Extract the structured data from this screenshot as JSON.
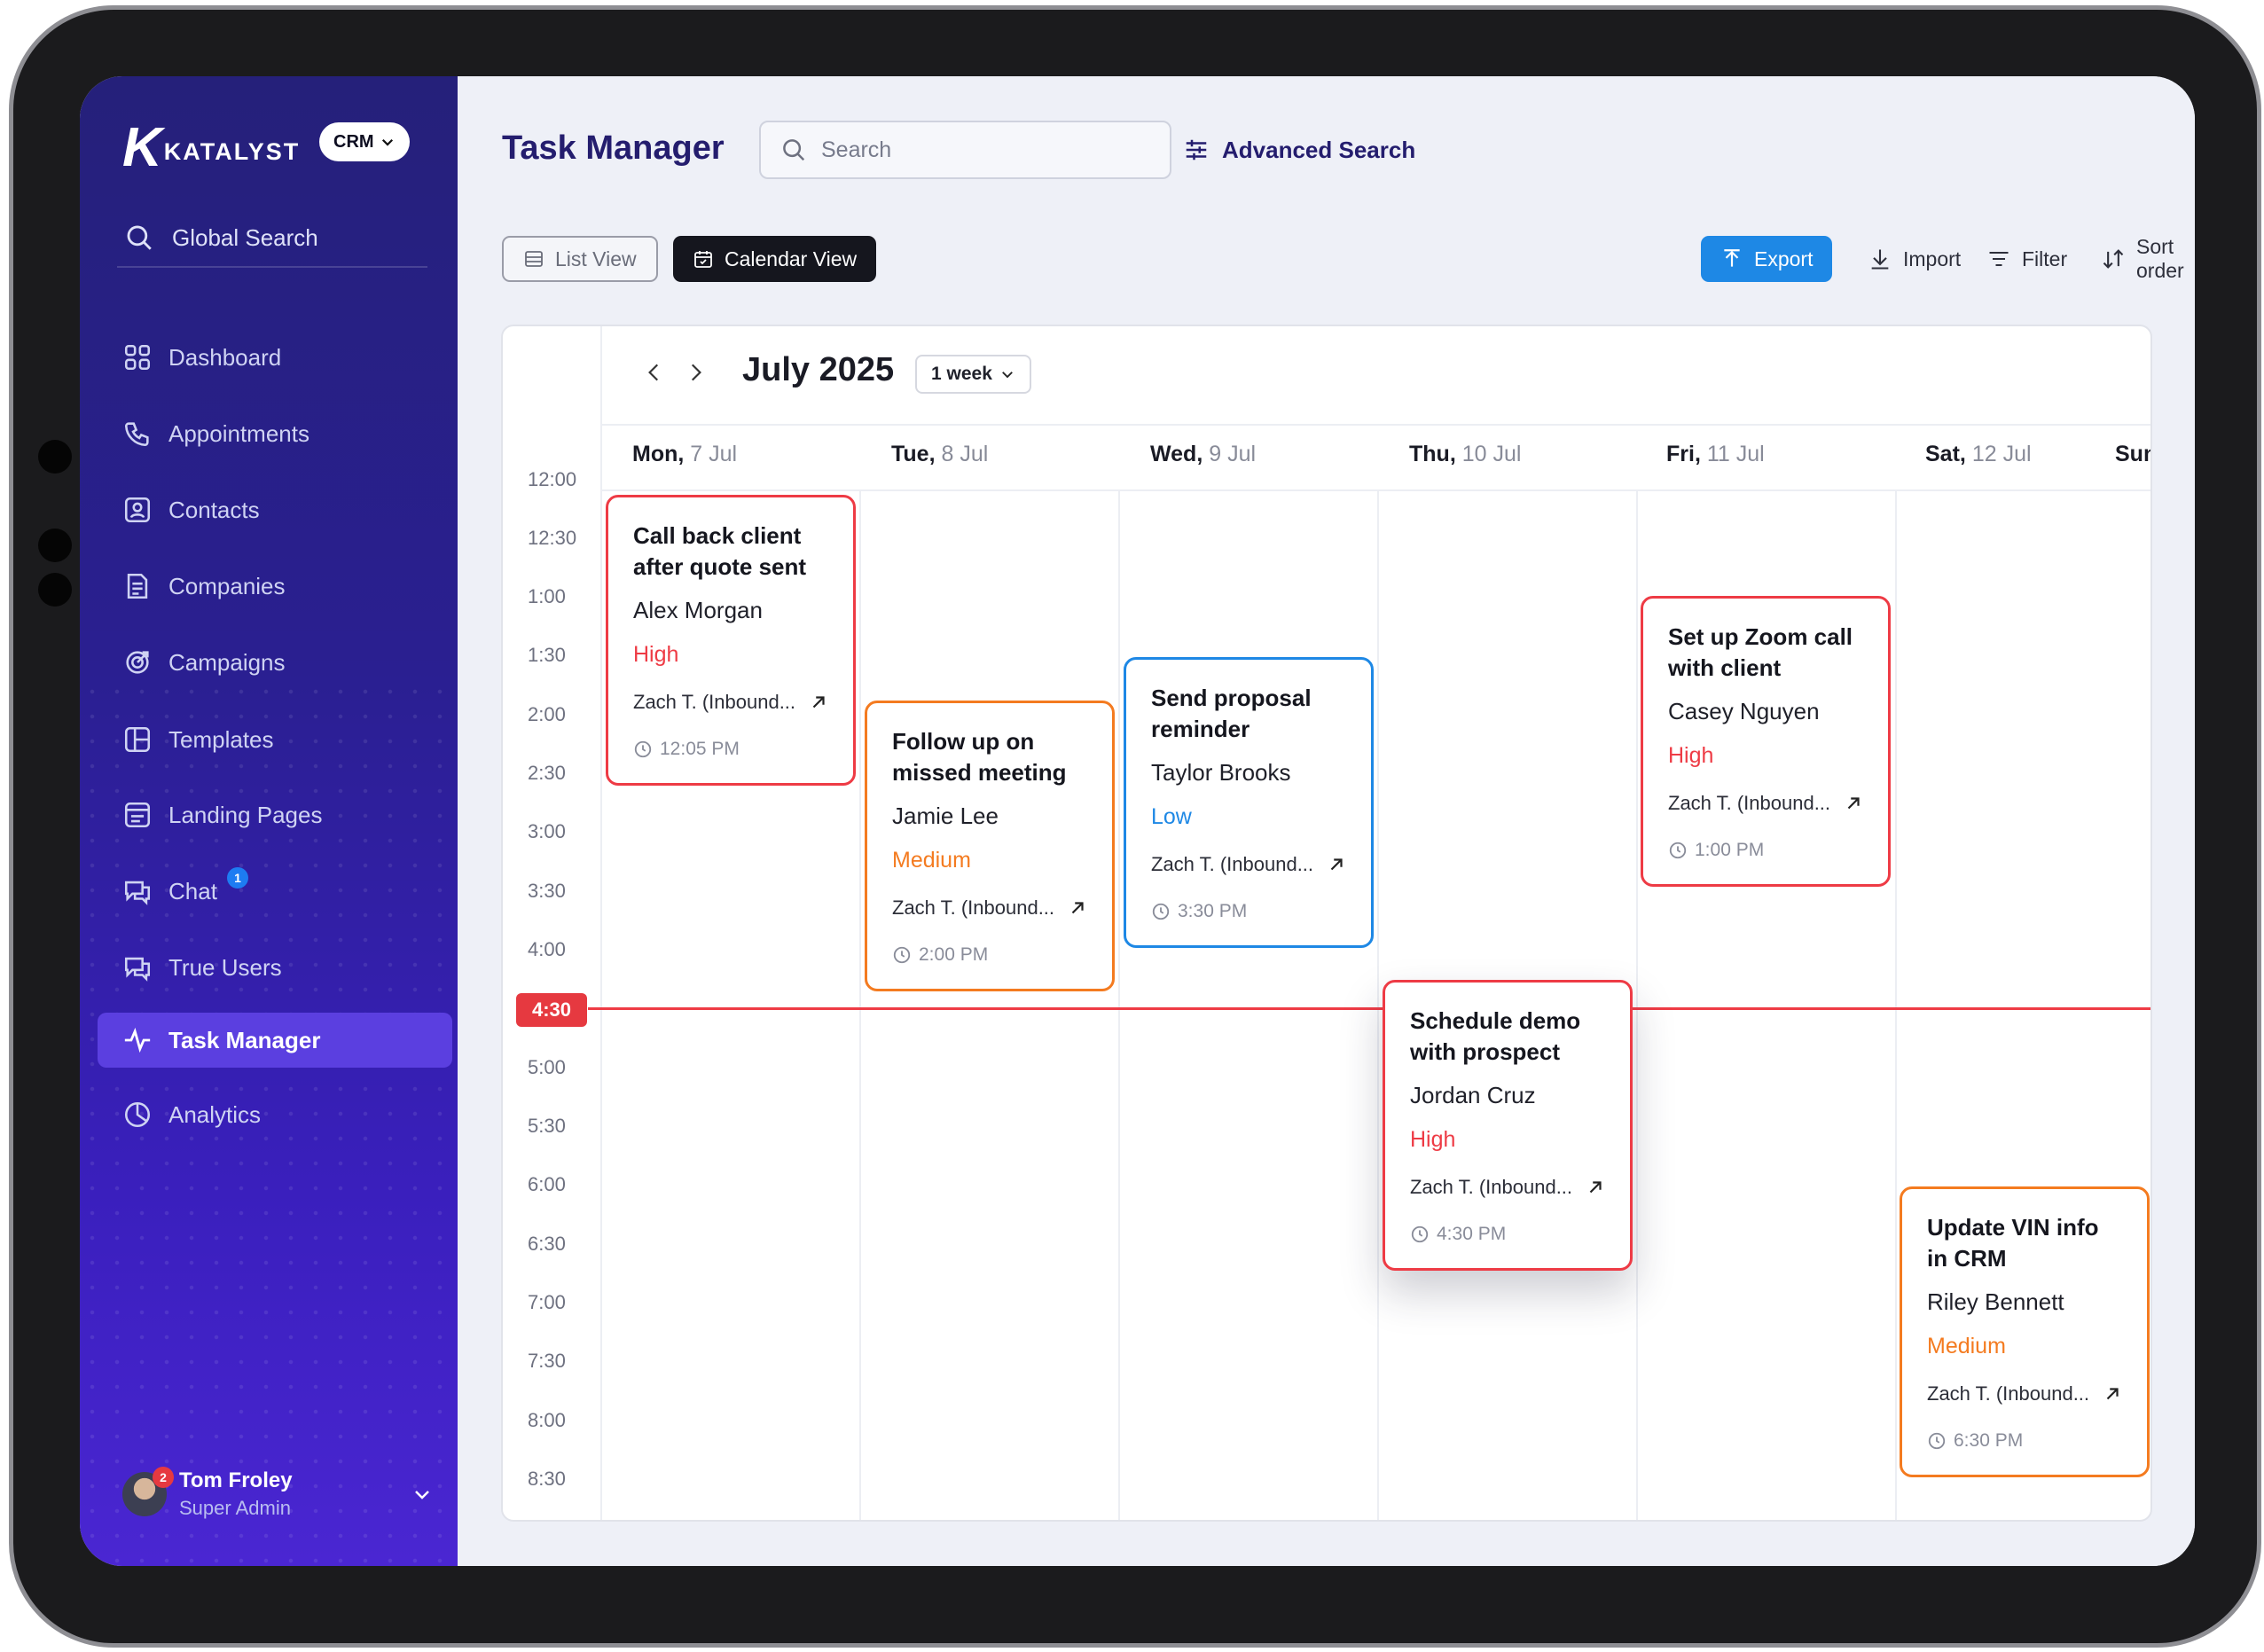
{
  "sidebar": {
    "brand": "KATALYST",
    "crm": "CRM",
    "global_search": "Global Search",
    "items": [
      {
        "label": "Dashboard",
        "icon": "grid-icon"
      },
      {
        "label": "Appointments",
        "icon": "phone-icon"
      },
      {
        "label": "Contacts",
        "icon": "contact-icon"
      },
      {
        "label": "Companies",
        "icon": "document-icon"
      },
      {
        "label": "Campaigns",
        "icon": "target-icon"
      },
      {
        "label": "Templates",
        "icon": "layout-icon"
      },
      {
        "label": "Landing Pages",
        "icon": "page-icon"
      },
      {
        "label": "Chat",
        "icon": "chat-icon"
      },
      {
        "label": "True Users",
        "icon": "users-chat-icon"
      },
      {
        "label": "Task Manager",
        "icon": "pulse-icon"
      },
      {
        "label": "Analytics",
        "icon": "pie-icon"
      }
    ],
    "chat_badge": "1",
    "user": {
      "name": "Tom Froley",
      "role": "Super Admin",
      "badge": "2"
    }
  },
  "header": {
    "title": "Task Manager",
    "search_placeholder": "Search",
    "advanced_search": "Advanced Search"
  },
  "toolbar": {
    "list_view": "List View",
    "calendar_view": "Calendar View",
    "export": "Export",
    "import": "Import",
    "filter": "Filter",
    "sort": "Sort order"
  },
  "calendar": {
    "month": "July 2025",
    "range": "1 week",
    "days": [
      {
        "name": "Mon,",
        "date": "7 Jul"
      },
      {
        "name": "Tue,",
        "date": "8 Jul"
      },
      {
        "name": "Wed,",
        "date": "9 Jul"
      },
      {
        "name": "Thu,",
        "date": "10 Jul"
      },
      {
        "name": "Fri,",
        "date": "11 Jul"
      },
      {
        "name": "Sat,",
        "date": "12 Jul"
      },
      {
        "name": "Sun",
        "date": ""
      }
    ],
    "times": [
      "12:00",
      "12:30",
      "1:00",
      "1:30",
      "2:00",
      "2:30",
      "3:00",
      "3:30",
      "4:00",
      "4:30",
      "5:00",
      "5:30",
      "6:00",
      "6:30",
      "7:00",
      "7:30",
      "8:00",
      "8:30"
    ],
    "now": "4:30",
    "tasks": [
      {
        "title": "Call back client after quote sent",
        "person": "Alex Morgan",
        "priority": "High",
        "assignee": "Zach T. (Inbound...",
        "time": "12:05 PM",
        "color": "#ee3b45"
      },
      {
        "title": "Follow up on missed meeting",
        "person": "Jamie Lee",
        "priority": "Medium",
        "assignee": "Zach T. (Inbound...",
        "time": "2:00 PM",
        "color": "#f47b20"
      },
      {
        "title": "Send proposal reminder",
        "person": "Taylor Brooks",
        "priority": "Low",
        "assignee": "Zach T. (Inbound...",
        "time": "3:30 PM",
        "color": "#1e88e5"
      },
      {
        "title": "Schedule demo with prospect",
        "person": "Jordan Cruz",
        "priority": "High",
        "assignee": "Zach T. (Inbound...",
        "time": "4:30 PM",
        "color": "#ee3b45"
      },
      {
        "title": "Set up Zoom call with client",
        "person": "Casey Nguyen",
        "priority": "High",
        "assignee": "Zach T. (Inbound...",
        "time": "1:00 PM",
        "color": "#ee3b45"
      },
      {
        "title": "Update VIN info in CRM",
        "person": "Riley Bennett",
        "priority": "Medium",
        "assignee": "Zach T. (Inbound...",
        "time": "6:30 PM",
        "color": "#f47b20"
      }
    ]
  }
}
